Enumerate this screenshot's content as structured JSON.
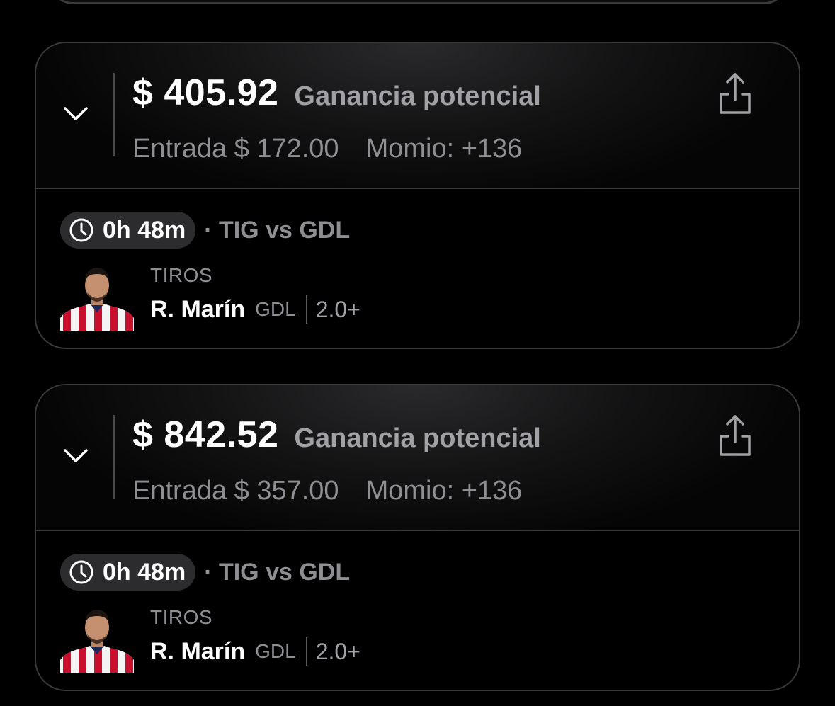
{
  "bets": [
    {
      "amount": "$ 405.92",
      "amount_label": "Ganancia potencial",
      "entry": "Entrada $ 172.00",
      "momio": "Momio: +136",
      "time": "0h 48m",
      "match": "· TIG vs GDL",
      "category": "TIROS",
      "player": "R. Marín",
      "team": "GDL",
      "line": "2.0+"
    },
    {
      "amount": "$ 842.52",
      "amount_label": "Ganancia potencial",
      "entry": "Entrada $ 357.00",
      "momio": "Momio: +136",
      "time": "0h 48m",
      "match": "· TIG vs GDL",
      "category": "TIROS",
      "player": "R. Marín",
      "team": "GDL",
      "line": "2.0+"
    }
  ],
  "icons": {
    "expand": "chevron-down-icon",
    "share": "share-icon",
    "clock": "clock-icon"
  },
  "colors": {
    "background": "#000000",
    "card_border": "#3a3a3c",
    "muted_text": "#8e8e93",
    "pill_bg": "#2c2c2e",
    "jersey_red": "#c8102e"
  }
}
